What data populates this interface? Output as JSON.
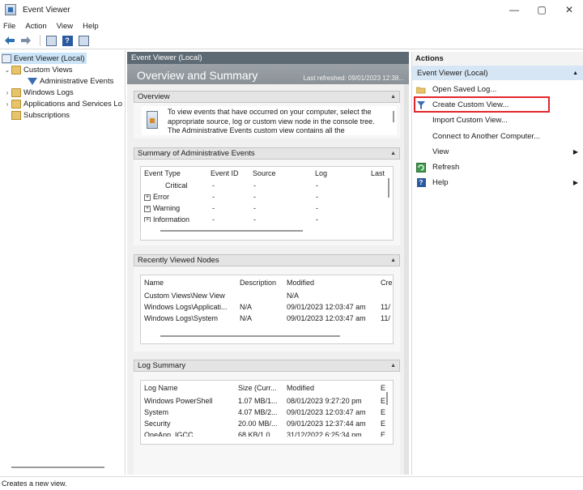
{
  "window": {
    "title": "Event Viewer",
    "minimize_glyph": "—",
    "maximize_glyph": "▢",
    "close_glyph": "✕"
  },
  "menu": [
    {
      "label": "File"
    },
    {
      "label": "Action"
    },
    {
      "label": "View"
    },
    {
      "label": "Help"
    }
  ],
  "toolbar": {
    "icons": [
      "back-arrow-icon",
      "forward-arrow-icon",
      "show-hide-tree-icon",
      "help-icon",
      "show-hide-action-pane-icon"
    ]
  },
  "tree": {
    "root": "Event Viewer (Local)",
    "custom_views": "Custom Views",
    "administrative_events": "Administrative Events",
    "windows_logs": "Windows Logs",
    "applications_services": "Applications and Services Lo",
    "subscriptions": "Subscriptions"
  },
  "center": {
    "header": "Event Viewer (Local)",
    "banner_title": "Overview and Summary",
    "last_refreshed": "Last refreshed: 09/01/2023 12:38...",
    "overview": {
      "title": "Overview",
      "text": "To view events that have occurred on your computer, select the appropriate source, log or custom view node in the console tree. The Administrative Events custom view contains all the"
    },
    "admin_summary": {
      "title": "Summary of Administrative Events",
      "columns": [
        "Event Type",
        "Event ID",
        "Source",
        "Log",
        "Last"
      ],
      "rows": [
        {
          "type": "Critical",
          "id": "-",
          "source": "-",
          "log": "-",
          "expander": false
        },
        {
          "type": "Error",
          "id": "-",
          "source": "-",
          "log": "-",
          "expander": true
        },
        {
          "type": "Warning",
          "id": "-",
          "source": "-",
          "log": "-",
          "expander": true
        },
        {
          "type": "Information",
          "id": "-",
          "source": "-",
          "log": "-",
          "expander": true
        }
      ]
    },
    "recent_nodes": {
      "title": "Recently Viewed Nodes",
      "columns": [
        "Name",
        "Description",
        "Modified",
        "Cre"
      ],
      "rows": [
        {
          "name": "Custom Views\\New View",
          "description": "",
          "modified": "N/A",
          "created": ""
        },
        {
          "name": "Windows Logs\\Applicati...",
          "description": "N/A",
          "modified": "09/01/2023 12:03:47 am",
          "created": "11/"
        },
        {
          "name": "Windows Logs\\System",
          "description": "N/A",
          "modified": "09/01/2023 12:03:47 am",
          "created": "11/"
        }
      ]
    },
    "log_summary": {
      "title": "Log Summary",
      "columns": [
        "Log Name",
        "Size (Curr...",
        "Modified",
        "E"
      ],
      "rows": [
        {
          "name": "Windows PowerShell",
          "size": "1.07 MB/1...",
          "modified": "08/01/2023 9:27:20 pm",
          "e": "E"
        },
        {
          "name": "System",
          "size": "4.07 MB/2...",
          "modified": "09/01/2023 12:03:47 am",
          "e": "E"
        },
        {
          "name": "Security",
          "size": "20.00 MB/...",
          "modified": "09/01/2023 12:37:44 am",
          "e": "E"
        },
        {
          "name": "OneApp_IGCC",
          "size": "68 KB/1.0...",
          "modified": "31/12/2022 6:25:34 pm",
          "e": "E"
        }
      ]
    }
  },
  "actions": {
    "title": "Actions",
    "group": "Event Viewer (Local)",
    "items": [
      {
        "label": "Open Saved Log...",
        "icon": "open-folder-icon",
        "submenu": false
      },
      {
        "label": "Create Custom View...",
        "icon": "filter-icon",
        "submenu": false
      },
      {
        "label": "Import Custom View...",
        "icon": "",
        "submenu": false
      },
      {
        "label": "Connect to Another Computer...",
        "icon": "",
        "submenu": false
      },
      {
        "label": "View",
        "icon": "",
        "submenu": true
      },
      {
        "label": "Refresh",
        "icon": "refresh-icon",
        "submenu": false
      },
      {
        "label": "Help",
        "icon": "help-icon",
        "submenu": true
      }
    ],
    "highlighted": "Create Custom View...",
    "highlight_color": "#e2262d"
  },
  "status": {
    "text": "Creates a new view."
  },
  "colors": {
    "accent": "#2f6fb3",
    "selection": "#cce4f7",
    "actions_group_bg": "#d6e6f5",
    "center_header_bg": "#5e6a73"
  }
}
